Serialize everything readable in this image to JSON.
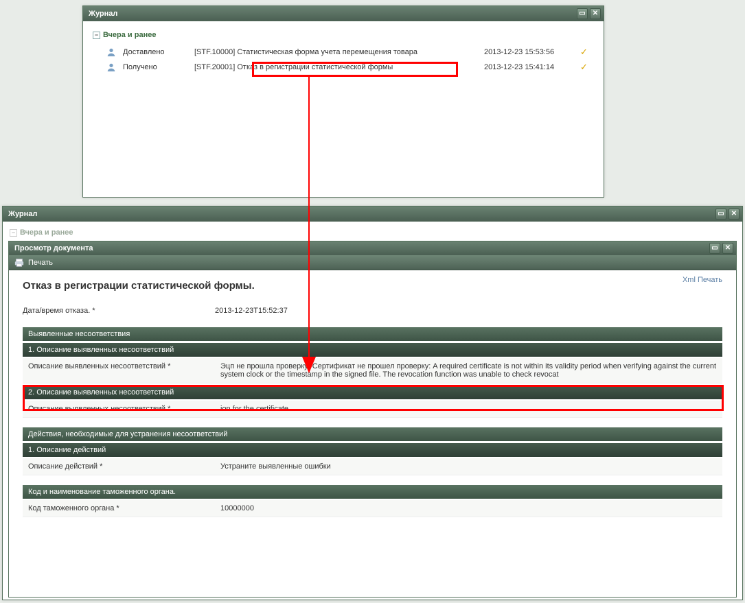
{
  "top_journal": {
    "title": "Журнал",
    "group_label": "Вчера и ранее",
    "rows": [
      {
        "status": "Доставлено",
        "subject": "[STF.10000] Статистическая форма учета перемещения товара",
        "ts": "2013-12-23 15:53:56"
      },
      {
        "status": "Получено",
        "subject": "[STF.20001] Отказ в регистрации статистической формы",
        "ts": "2013-12-23 15:41:14"
      }
    ]
  },
  "bottom_journal": {
    "title": "Журнал",
    "group_label": "Вчера и ранее"
  },
  "doc_viewer": {
    "title": "Просмотр документа",
    "toolbar_print": "Печать",
    "xml_link": "Xml Печать",
    "doc_title": "Отказ в регистрации статистической формы.",
    "datetime_label": "Дата/время отказа. *",
    "datetime_value": "2013-12-23T15:52:37",
    "sections": {
      "discrepancies": {
        "header": "Выявленные несоответствия",
        "items": [
          {
            "sub_header": "1. Описание выявленных несоответствий",
            "label": "Описание выявленных несоответствий *",
            "value": "Эцп не прошла проверку: Сертификат не прошел проверку: A required certificate is not within its validity period when verifying against the current system clock or the timestamp in the signed file. The revocation function was unable to check revocat"
          },
          {
            "sub_header": "2. Описание выявленных несоответствий",
            "label": "Описание выявленных несоответствий *",
            "value": "ion for the certificate."
          }
        ]
      },
      "actions": {
        "header": "Действия, необходимые для устранения несоответствий",
        "items": [
          {
            "sub_header": "1. Описание действий",
            "label": "Описание действий *",
            "value": "Устраните выявленные ошибки"
          }
        ]
      },
      "customs": {
        "header": "Код и наименование таможенного органа.",
        "label": "Код таможенного органа *",
        "value": "10000000"
      }
    }
  }
}
